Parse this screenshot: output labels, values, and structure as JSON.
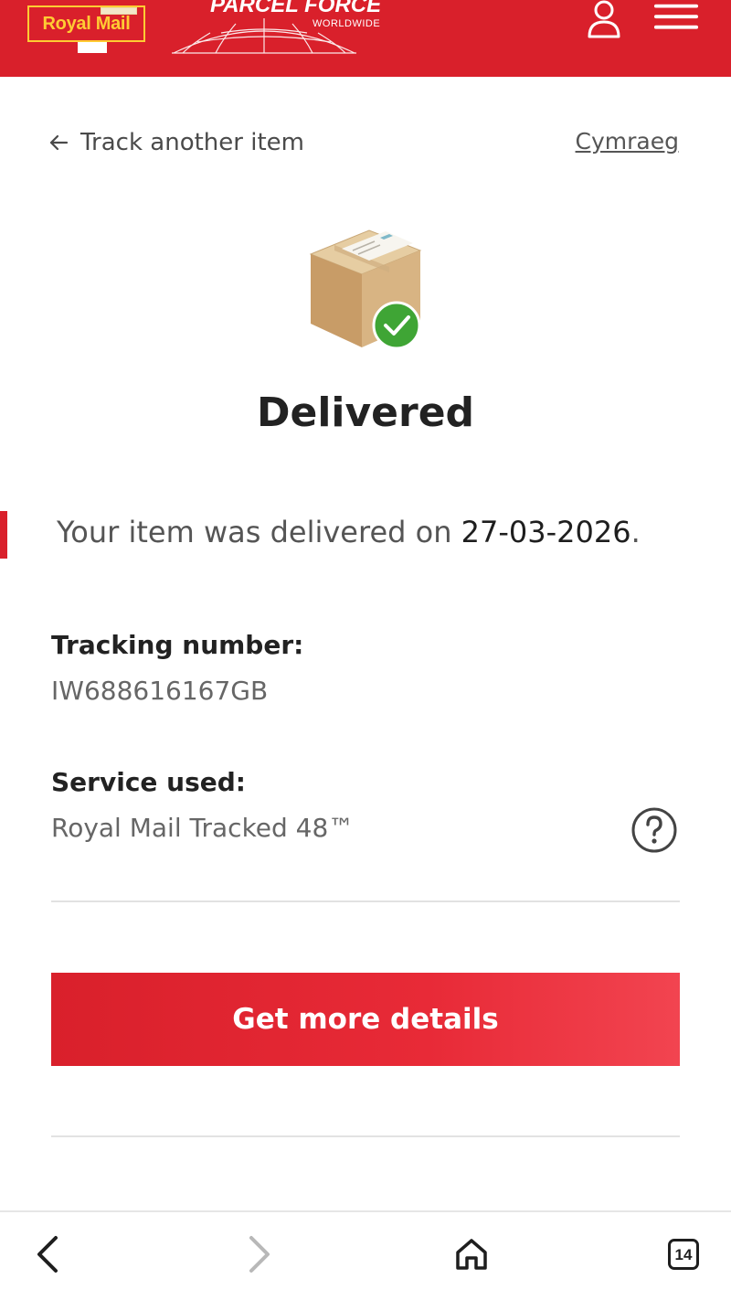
{
  "header": {
    "royal_mail_logo": "Royal Mail",
    "parcelforce_logo": "PARCEL FORCE",
    "parcelforce_sub": "WORLDWIDE",
    "account_icon": "user-icon",
    "menu_icon": "hamburger-menu-icon"
  },
  "nav": {
    "back_label": "Track another item",
    "back_icon": "arrow-left-icon",
    "language_link": "Cymraeg"
  },
  "status": {
    "icon": "parcel-delivered-icon",
    "title": "Delivered",
    "message_prefix": "Your item was delivered on ",
    "date": "27-03-2026",
    "message_suffix": "."
  },
  "details": {
    "tracking_label": "Tracking number:",
    "tracking_number": "IW688616167GB",
    "service_label": "Service used:",
    "service_value": "Royal Mail Tracked 48™",
    "help_icon": "question-circle-icon"
  },
  "actions": {
    "more_details_label": "Get more details"
  },
  "browser_bar": {
    "back_icon": "chevron-left-icon",
    "forward_icon": "chevron-right-icon",
    "home_icon": "home-icon",
    "tab_count": "14"
  },
  "colors": {
    "brand_red": "#d9202b",
    "brand_yellow": "#ffcc33",
    "success_green": "#3fa535",
    "text_dark": "#222222",
    "text_muted": "#666666"
  }
}
